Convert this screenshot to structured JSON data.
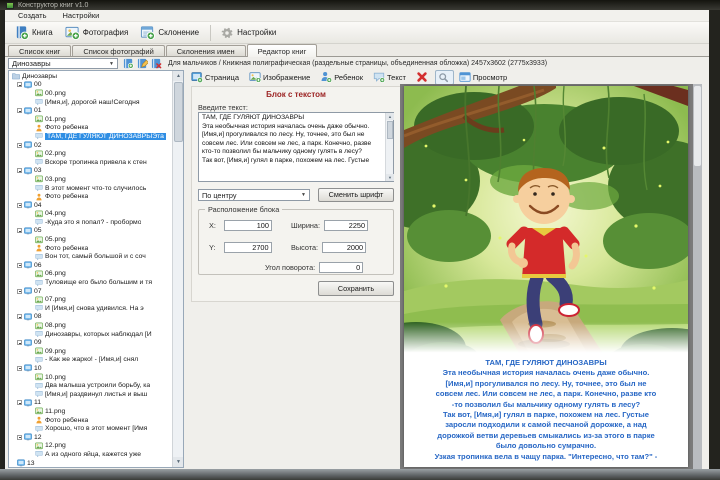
{
  "window": {
    "title": "Конструктор книг v1.0"
  },
  "menu": {
    "items": [
      {
        "label": "Создать"
      },
      {
        "label": "Настройки"
      }
    ]
  },
  "toolbar": {
    "buttons": [
      {
        "label": "Книга",
        "icon": "book-add"
      },
      {
        "label": "Фотография",
        "icon": "photo-add"
      },
      {
        "label": "Склонение",
        "icon": "declension-add"
      },
      {
        "label": "Настройки",
        "icon": "gear"
      }
    ]
  },
  "tabs": [
    {
      "label": "Список книг",
      "active": false
    },
    {
      "label": "Список фотографий",
      "active": false
    },
    {
      "label": "Склонения имен",
      "active": false
    },
    {
      "label": "Редактор книг",
      "active": true
    }
  ],
  "book_bar": {
    "selected_book": "Динозавры",
    "buttons": [
      {
        "icon": "book-add-small"
      },
      {
        "icon": "book-edit-small"
      },
      {
        "icon": "book-delete-small"
      }
    ],
    "info": "Для мальчиков / Книжная полиграфическая (раздельные страницы, объединенная обложка) 2457x3602 (2775x3933)"
  },
  "editor_toolbar": {
    "buttons": [
      {
        "label": "Страница",
        "icon": "page-add"
      },
      {
        "label": "Изображение",
        "icon": "image-add"
      },
      {
        "label": "Ребенок",
        "icon": "child-add"
      },
      {
        "label": "Текст",
        "icon": "text-add"
      },
      {
        "label": "",
        "icon": "delete-x"
      },
      {
        "label": "",
        "icon": "magnifier",
        "boxed": true
      },
      {
        "label": "Просмотр",
        "icon": "preview-window"
      }
    ]
  },
  "tree": {
    "root": "Динозавры",
    "selected_label": "ТАМ, ГДЕ ГУЛЯЮТ ДИНОЗАВРЫЭта",
    "pages": [
      {
        "id": "00",
        "items": [
          {
            "type": "image",
            "label": "00.png"
          },
          {
            "type": "text",
            "label": "[Имя,и], дорогой наш!Сегодня"
          }
        ]
      },
      {
        "id": "01",
        "items": [
          {
            "type": "image",
            "label": "01.png"
          },
          {
            "type": "child",
            "label": "Фото ребенка"
          },
          {
            "type": "text",
            "label": "ТАМ, ГДЕ ГУЛЯЮТ ДИНОЗАВРЫЭта",
            "selected": true
          }
        ]
      },
      {
        "id": "02",
        "items": [
          {
            "type": "image",
            "label": "02.png"
          },
          {
            "type": "text",
            "label": "Вскоре тропинка привела к стен"
          }
        ]
      },
      {
        "id": "03",
        "items": [
          {
            "type": "image",
            "label": "03.png"
          },
          {
            "type": "text",
            "label": "В этот момент что-то случилось"
          },
          {
            "type": "child",
            "label": "Фото ребенка"
          }
        ]
      },
      {
        "id": "04",
        "items": [
          {
            "type": "image",
            "label": "04.png"
          },
          {
            "type": "text",
            "label": "-Куда это я попал? - пробормо"
          }
        ]
      },
      {
        "id": "05",
        "items": [
          {
            "type": "image",
            "label": "05.png"
          },
          {
            "type": "child",
            "label": "Фото ребенка"
          },
          {
            "type": "text",
            "label": "Вон тот, самый большой и с соч"
          }
        ]
      },
      {
        "id": "06",
        "items": [
          {
            "type": "image",
            "label": "06.png"
          },
          {
            "type": "text",
            "label": "Туловище его было большим и тя"
          }
        ]
      },
      {
        "id": "07",
        "items": [
          {
            "type": "image",
            "label": "07.png"
          },
          {
            "type": "text",
            "label": "И [Имя,и] снова удивился. На э"
          }
        ]
      },
      {
        "id": "08",
        "items": [
          {
            "type": "image",
            "label": "08.png"
          },
          {
            "type": "text",
            "label": "Динозавры, которых наблюдал [И"
          }
        ]
      },
      {
        "id": "09",
        "items": [
          {
            "type": "image",
            "label": "09.png"
          },
          {
            "type": "text",
            "label": "- Как же жарко! - [Имя,и] снял"
          }
        ]
      },
      {
        "id": "10",
        "items": [
          {
            "type": "image",
            "label": "10.png"
          },
          {
            "type": "text",
            "label": "Два малыша устроили борьбу, ка"
          },
          {
            "type": "text",
            "label": "[Имя,и] раздвинул листья и выш"
          }
        ]
      },
      {
        "id": "11",
        "items": [
          {
            "type": "image",
            "label": "11.png"
          },
          {
            "type": "child",
            "label": "Фото ребенка"
          },
          {
            "type": "text",
            "label": "Хорошо, что в этот момент [Имя"
          }
        ]
      },
      {
        "id": "12",
        "items": [
          {
            "type": "image",
            "label": "12.png"
          },
          {
            "type": "text",
            "label": "А из одного яйца, кажется уже"
          }
        ]
      },
      {
        "id": "13",
        "items": []
      }
    ]
  },
  "text_block_panel": {
    "title": "Блок с текстом",
    "input_label": "Введите текст:",
    "text": "ТАМ, ГДЕ ГУЛЯЮТ ДИНОЗАВРЫ\nЭта необычная история началась очень даже обычно. [Имя,и] прогуливался по лесу. Ну, точнее, это был не совсем лес. Или совсем не лес, а парк. Конечно, разве кто-то позволил бы мальчику одному гулять в лесу?\nТак вот, [Имя,и] гулял в парке, похожем на лес. Густые",
    "alignment_value": "По центру",
    "change_font_label": "Сменить шрифт",
    "position_group": {
      "title": "Расположение блока",
      "fields": [
        {
          "key": "x",
          "label": "X:",
          "value": "100"
        },
        {
          "key": "y",
          "label": "Y:",
          "value": "2700"
        },
        {
          "key": "width",
          "label": "Ширина:",
          "value": "2250"
        },
        {
          "key": "height",
          "label": "Высота:",
          "value": "2000"
        },
        {
          "key": "angle",
          "label": "Угол поворота:",
          "value": "0"
        }
      ]
    },
    "save_label": "Сохранить"
  },
  "preview": {
    "text_color": "#2767c5",
    "lines": [
      "ТАМ, ГДЕ ГУЛЯЮТ ДИНОЗАВРЫ",
      "Эта необычная история началась очень даже обычно.",
      "[Имя,и] прогуливался по лесу. Ну, точнее, это был не",
      "совсем лес. Или совсем не лес, а парк. Конечно, разве кто",
      "-то позволил бы мальчику одному гулять в лесу?",
      "Так вот, [Имя,и] гулял в парке, похожем на лес. Густые",
      "заросли подходили к самой песчаной дорожке, а над",
      "дорожкой ветви деревьев смыкались из-за этого в парке",
      "было довольно сумрачно.",
      "Узкая тропинка вела в чащу парка. \"Интересно, что там?\" -"
    ]
  },
  "colors": {
    "panel_header": "#9c2424",
    "tree_selection": "#2f8ee4",
    "preview_bg": "#7b7b7b",
    "accent_green": "#43a047"
  }
}
